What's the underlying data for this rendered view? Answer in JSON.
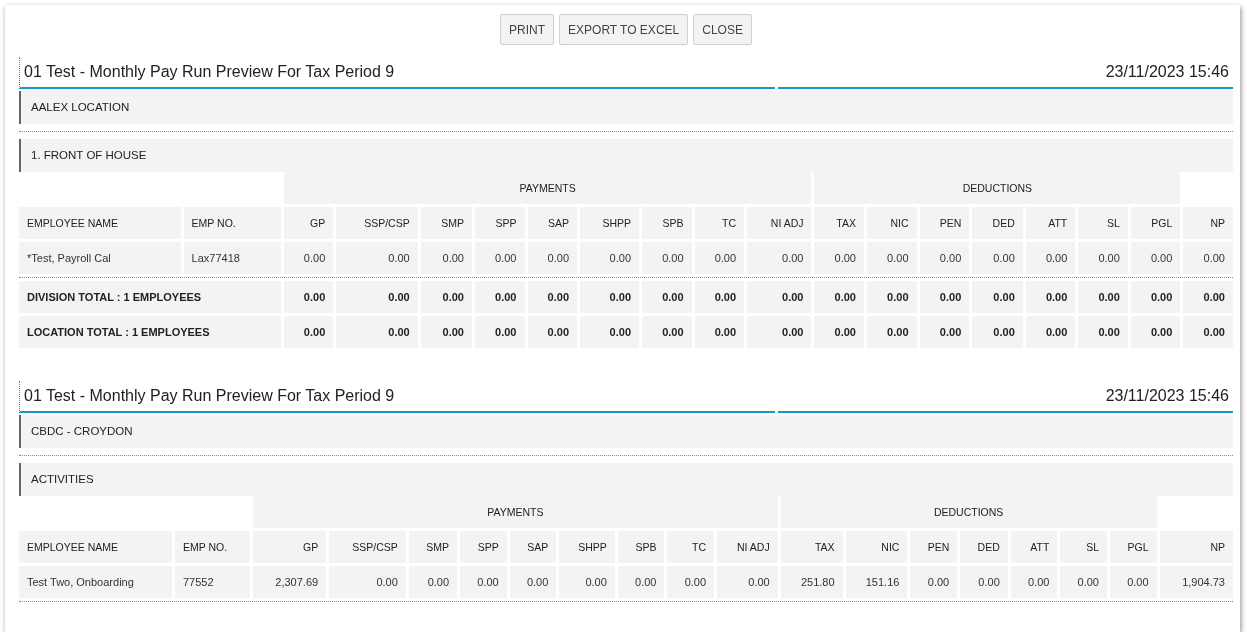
{
  "toolbar": {
    "buttons": [
      "PRINT",
      "EXPORT TO EXCEL",
      "CLOSE"
    ]
  },
  "reports": [
    {
      "title": "01 Test - Monthly Pay Run Preview For Tax Period 9",
      "timestamp": "23/11/2023 15:46",
      "location": "AALEX LOCATION",
      "division": "1. FRONT OF HOUSE",
      "leading_columns": [
        "EMPLOYEE NAME",
        "EMP NO."
      ],
      "column_groups": [
        {
          "label": "PAYMENTS",
          "columns": [
            "GP",
            "SSP/CSP",
            "SMP",
            "SPP",
            "SAP",
            "SHPP",
            "SPB",
            "TC",
            "NI ADJ"
          ]
        },
        {
          "label": "DEDUCTIONS",
          "columns": [
            "TAX",
            "NIC",
            "PEN",
            "DED",
            "ATT",
            "SL",
            "PGL"
          ]
        }
      ],
      "trailing_columns": [
        "NP"
      ],
      "rows": [
        {
          "cells": [
            "*Test, Payroll Cal",
            "Lax77418",
            "0.00",
            "0.00",
            "0.00",
            "0.00",
            "0.00",
            "0.00",
            "0.00",
            "0.00",
            "0.00",
            "0.00",
            "0.00",
            "0.00",
            "0.00",
            "0.00",
            "0.00",
            "0.00",
            "0.00"
          ]
        }
      ],
      "totals": [
        {
          "label": "DIVISION TOTAL : 1 EMPLOYEES",
          "values": [
            "0.00",
            "0.00",
            "0.00",
            "0.00",
            "0.00",
            "0.00",
            "0.00",
            "0.00",
            "0.00",
            "0.00",
            "0.00",
            "0.00",
            "0.00",
            "0.00",
            "0.00",
            "0.00",
            "0.00"
          ]
        },
        {
          "label": "LOCATION TOTAL : 1 EMPLOYEES",
          "values": [
            "0.00",
            "0.00",
            "0.00",
            "0.00",
            "0.00",
            "0.00",
            "0.00",
            "0.00",
            "0.00",
            "0.00",
            "0.00",
            "0.00",
            "0.00",
            "0.00",
            "0.00",
            "0.00",
            "0.00"
          ]
        }
      ]
    },
    {
      "title": "01 Test - Monthly Pay Run Preview For Tax Period 9",
      "timestamp": "23/11/2023 15:46",
      "location": "CBDC - CROYDON",
      "division": "ACTIVITIES",
      "leading_columns": [
        "EMPLOYEE NAME",
        "EMP NO."
      ],
      "column_groups": [
        {
          "label": "PAYMENTS",
          "columns": [
            "GP",
            "SSP/CSP",
            "SMP",
            "SPP",
            "SAP",
            "SHPP",
            "SPB",
            "TC",
            "NI ADJ"
          ]
        },
        {
          "label": "DEDUCTIONS",
          "columns": [
            "TAX",
            "NIC",
            "PEN",
            "DED",
            "ATT",
            "SL",
            "PGL"
          ]
        }
      ],
      "trailing_columns": [
        "NP"
      ],
      "rows": [
        {
          "cells": [
            "Test Two, Onboarding",
            "77552",
            "2,307.69",
            "0.00",
            "0.00",
            "0.00",
            "0.00",
            "0.00",
            "0.00",
            "0.00",
            "0.00",
            "251.80",
            "151.16",
            "0.00",
            "0.00",
            "0.00",
            "0.00",
            "0.00",
            "1,904.73"
          ]
        }
      ]
    }
  ]
}
